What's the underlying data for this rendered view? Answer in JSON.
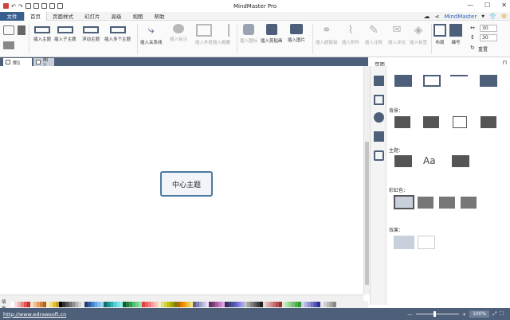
{
  "window": {
    "title": "MindMaster Pro"
  },
  "menu": {
    "file": "文件",
    "items": [
      "首页",
      "页面样式",
      "幻灯片",
      "高级",
      "视图",
      "帮助"
    ],
    "active_index": 0,
    "brand": "MindMaster"
  },
  "ribbon": {
    "insert_topic": "插入主题",
    "insert_subtopic": "插入子主题",
    "floating_topic": "浮动主题",
    "insert_multi": "插入多个主题",
    "insert_relation": "插入关系线",
    "insert_callout": "插入标注",
    "insert_boundary": "插入外框",
    "insert_summary": "插入概要",
    "insert_marker": "插入图标",
    "insert_clipart": "插入剪贴画",
    "insert_image": "插入图片",
    "insert_hyperlink": "插入超链接",
    "insert_attachment": "插入附件",
    "insert_note": "插入注释",
    "insert_comment": "插入评论",
    "insert_tag": "插入标签",
    "layout": "布局",
    "numbering": "编号",
    "spacing_h": "30",
    "spacing_v": "30",
    "reset": "重置"
  },
  "tabs": [
    {
      "label": "图1"
    },
    {
      "label": "图2"
    }
  ],
  "canvas": {
    "central_topic": "中心主题"
  },
  "panel": {
    "title": "页面",
    "background_label": "背景：",
    "theme_label": "主题：",
    "rainbow_label": "彩虹色：",
    "effect_label": "效果："
  },
  "palette": {
    "label": "填充"
  },
  "status": {
    "url": "http://www.edrawsoft.cn",
    "zoom": "100%"
  },
  "colors": {
    "accent": "#4d5f79",
    "topic_border": "#4d7aa3",
    "file_menu": "#3a5f8f",
    "swatches": [
      "#ffffff",
      "#f8d8d8",
      "#f0b0b0",
      "#e88080",
      "#e05050",
      "#c83030",
      "#f8e0c8",
      "#f0c090",
      "#e8a060",
      "#d08040",
      "#b06020",
      "#f8f0c0",
      "#f0e080",
      "#e0c040",
      "#c8a020",
      "#000000",
      "#303030",
      "#505050",
      "#707070",
      "#909090",
      "#b0b0b0",
      "#d0d0d0",
      "#e8e8e8",
      "#1f3f6f",
      "#2f5f9f",
      "#3f7fcf",
      "#5f9fdf",
      "#7fbfef",
      "#9fd0f0",
      "#0f6f6f",
      "#1f8f8f",
      "#2fafaf",
      "#4fcfcf",
      "#6fdfdf",
      "#8fefef",
      "#106030",
      "#208040",
      "#30a050",
      "#50c070",
      "#70d090",
      "#90e0b0",
      "#e04040",
      "#f06060",
      "#f08080",
      "#ffa0a0",
      "#ffc0c0",
      "#f0f0c0",
      "#e0e080",
      "#d0d040",
      "#c0c000",
      "#a0a000",
      "#808000",
      "#c06000",
      "#e08000",
      "#f0a000",
      "#f0c040",
      "#f0e080",
      "#606090",
      "#8080b0",
      "#a0a0d0",
      "#c0c0e0",
      "#e0e0f0",
      "#603060",
      "#804080",
      "#a060a0",
      "#c080c0",
      "#e0a0e0",
      "#303060",
      "#404080",
      "#5050a0",
      "#6060c0",
      "#8080e0",
      "#a0a0f0",
      "#c0c0c0",
      "#a0a0a0",
      "#808080",
      "#606060",
      "#404040",
      "#202020",
      "#f0d0d0",
      "#e0b0b0",
      "#d09090",
      "#c07070",
      "#b05050",
      "#a03030",
      "#d0f0d0",
      "#b0e0b0",
      "#90d090",
      "#70c070",
      "#50b050",
      "#30a030",
      "#d0d0f0",
      "#b0b0e0",
      "#9090d0",
      "#7070c0",
      "#5050b0",
      "#3030a0",
      "#e8e8e8",
      "#d0d0d0",
      "#b8b8b8",
      "#a0a0a0",
      "#888888"
    ]
  }
}
